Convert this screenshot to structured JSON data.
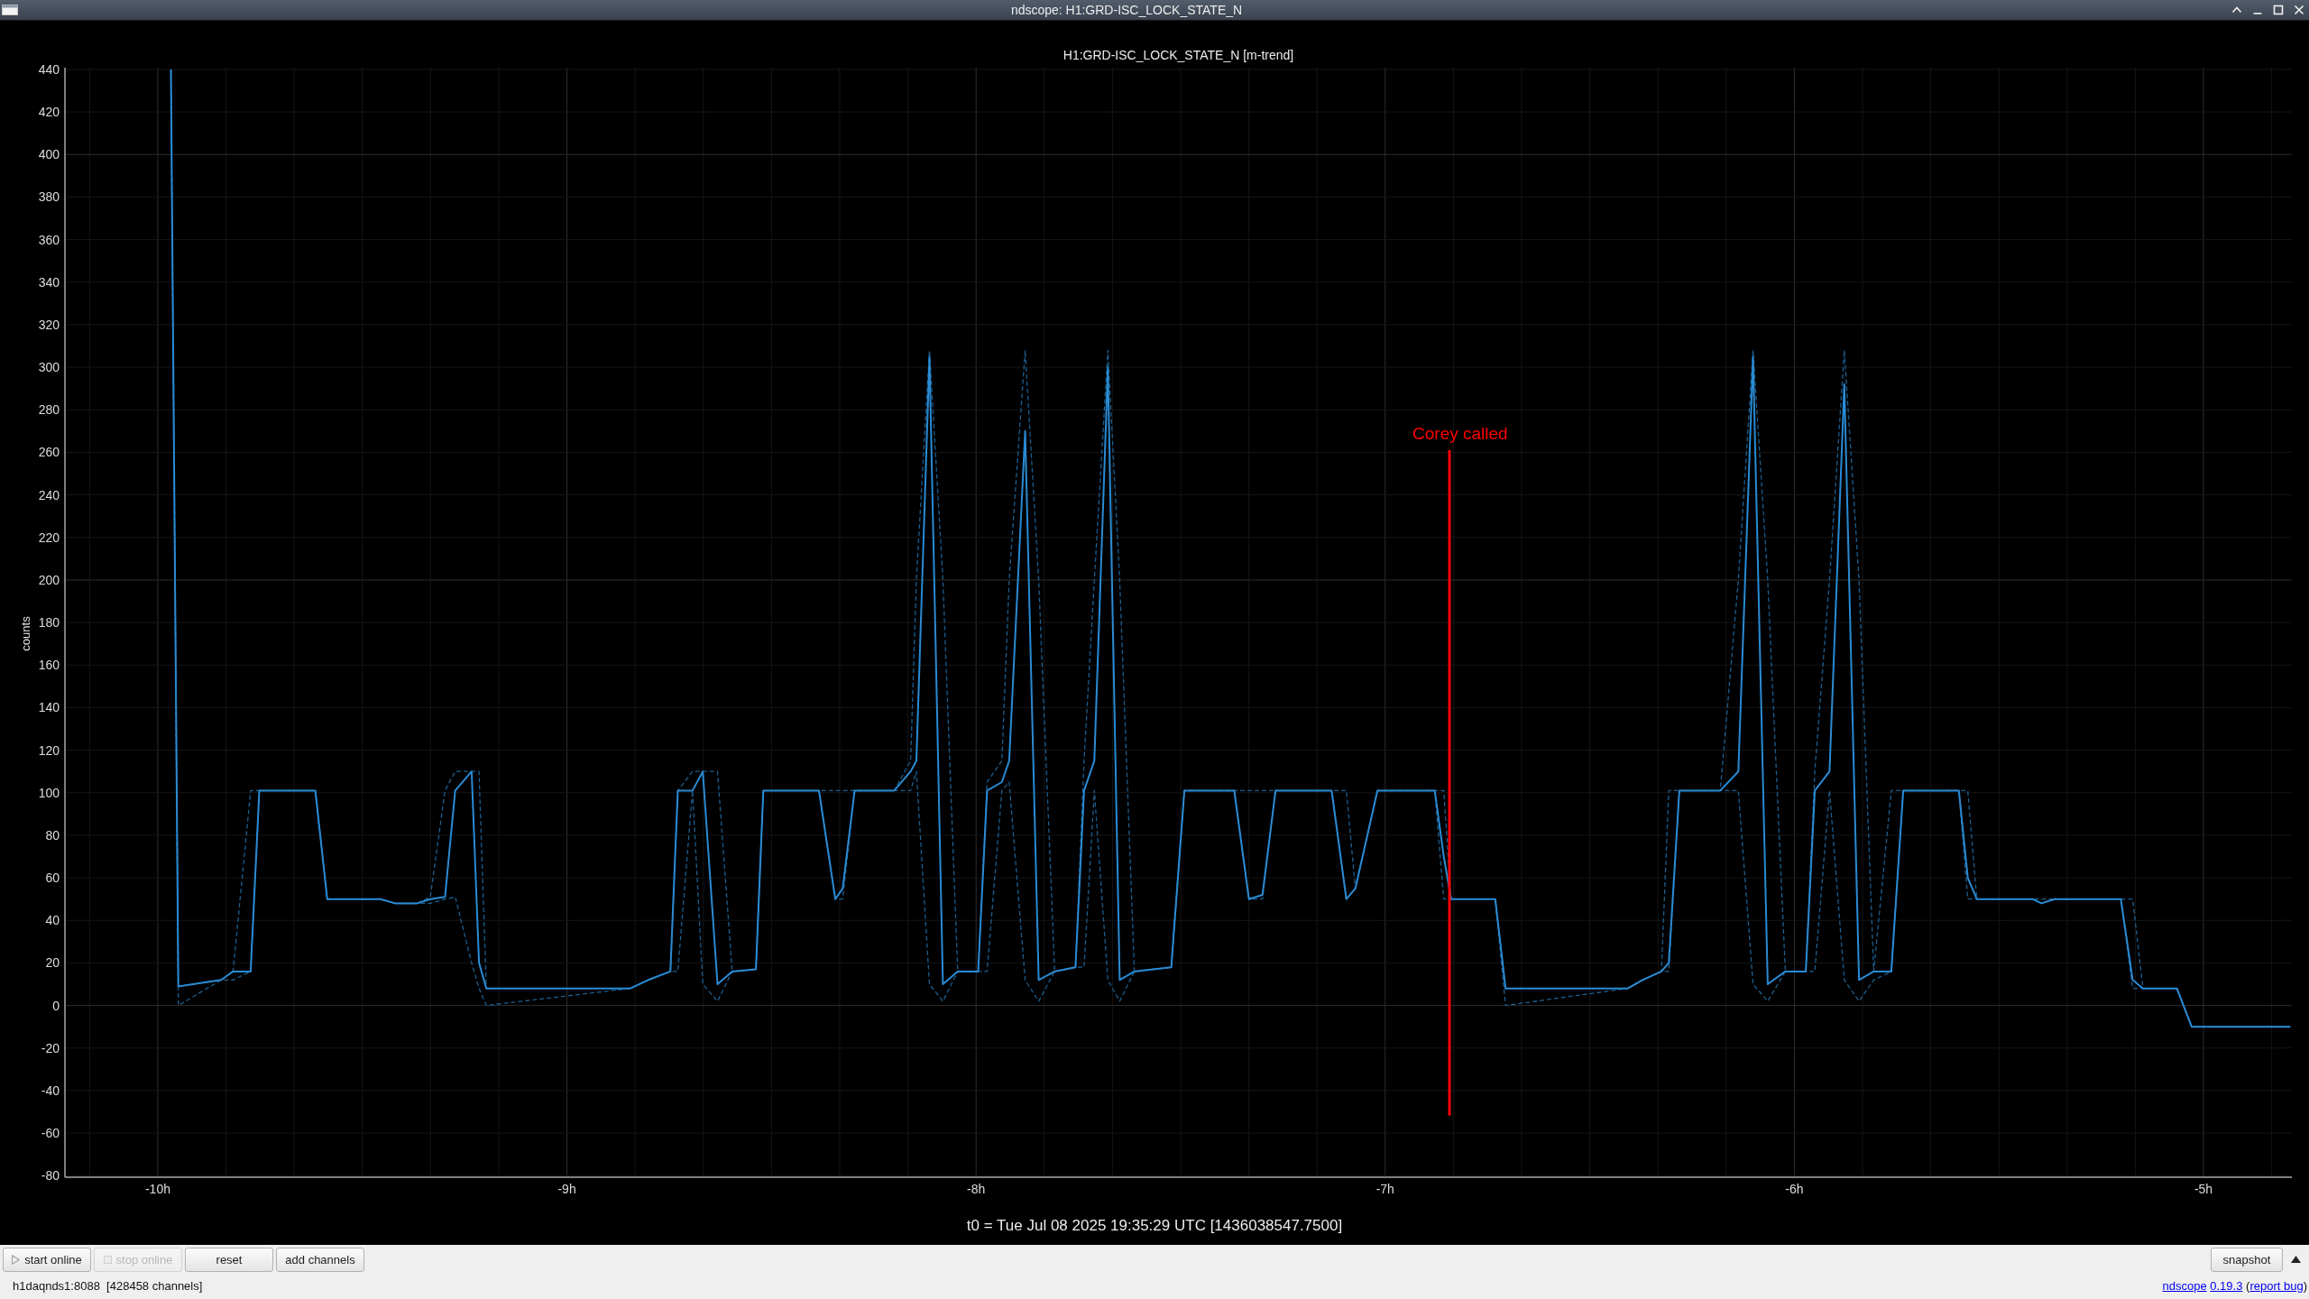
{
  "window": {
    "title": "ndscope: H1:GRD-ISC_LOCK_STATE_N"
  },
  "plot": {
    "chart_data": {
      "type": "line",
      "title": "H1:GRD-ISC_LOCK_STATE_N [m-trend]",
      "xlabel": "t0 = Tue Jul 08 2025 19:35:29 UTC [1436038547.7500]",
      "ylabel": "counts",
      "grid": true,
      "x": [
        -9.968,
        -9.95,
        -9.845,
        -9.816,
        -9.773,
        -9.752,
        -9.615,
        -9.586,
        -9.456,
        -9.42,
        -9.366,
        -9.334,
        -9.298,
        -9.273,
        -9.233,
        -9.215,
        -9.197,
        -8.845,
        -8.801,
        -8.747,
        -8.729,
        -8.693,
        -8.668,
        -8.632,
        -8.596,
        -8.538,
        -8.52,
        -8.384,
        -8.344,
        -8.326,
        -8.297,
        -8.2,
        -8.16,
        -8.146,
        -8.114,
        -8.081,
        -8.045,
        -7.995,
        -7.973,
        -7.937,
        -7.919,
        -7.88,
        -7.847,
        -7.808,
        -7.757,
        -7.736,
        -7.711,
        -7.678,
        -7.649,
        -7.613,
        -7.523,
        -7.491,
        -7.369,
        -7.333,
        -7.3,
        -7.268,
        -7.131,
        -7.095,
        -7.073,
        -7.019,
        -6.879,
        -6.857,
        -6.839,
        -6.731,
        -6.706,
        -6.407,
        -6.371,
        -6.325,
        -6.307,
        -6.281,
        -6.181,
        -6.137,
        -6.101,
        -6.065,
        -6.022,
        -5.972,
        -5.95,
        -5.914,
        -5.878,
        -5.842,
        -5.806,
        -5.763,
        -5.734,
        -5.598,
        -5.576,
        -5.554,
        -5.418,
        -5.396,
        -5.364,
        -5.202,
        -5.173,
        -5.148,
        -5.065,
        -5.029,
        -4.788
      ],
      "series": [
        {
          "line_style": "dashed",
          "color": "#1d5e8e",
          "values": [
            440,
            9,
            12,
            16,
            101,
            101,
            101,
            50,
            50,
            48,
            48,
            51,
            101,
            110,
            110,
            110,
            8,
            8,
            12,
            16,
            101,
            110,
            110,
            110,
            16,
            17,
            101,
            101,
            101,
            101,
            101,
            101,
            115,
            200,
            308,
            200,
            16,
            16,
            105,
            115,
            200,
            308,
            200,
            16,
            18,
            115,
            200,
            308,
            200,
            16,
            18,
            101,
            101,
            101,
            101,
            101,
            101,
            101,
            55,
            101,
            101,
            101,
            50,
            50,
            8,
            8,
            12,
            16,
            101,
            101,
            101,
            200,
            308,
            200,
            16,
            16,
            110,
            200,
            308,
            200,
            16,
            101,
            101,
            101,
            101,
            50,
            50,
            50,
            50,
            50,
            50,
            8,
            8,
            -10,
            -10
          ]
        },
        {
          "line_style": "dashed",
          "color": "#1d5e8e",
          "values": [
            440,
            0,
            12,
            12,
            16,
            101,
            101,
            50,
            50,
            48,
            48,
            48,
            50,
            51,
            20,
            8,
            0,
            8,
            12,
            16,
            16,
            101,
            10,
            2,
            16,
            17,
            101,
            101,
            50,
            50,
            101,
            101,
            101,
            110,
            10,
            2,
            16,
            16,
            16,
            101,
            105,
            12,
            2,
            16,
            18,
            18,
            101,
            12,
            2,
            16,
            18,
            101,
            101,
            50,
            50,
            101,
            101,
            50,
            55,
            101,
            101,
            50,
            50,
            50,
            0,
            8,
            12,
            16,
            16,
            101,
            101,
            101,
            10,
            2,
            16,
            16,
            16,
            101,
            12,
            2,
            12,
            16,
            101,
            101,
            50,
            50,
            50,
            48,
            50,
            50,
            8,
            8,
            8,
            -10,
            -10
          ]
        },
        {
          "line_style": "solid",
          "color": "#2a8bd4",
          "values": [
            440,
            9,
            12,
            16,
            16,
            101,
            101,
            50,
            50,
            48,
            48,
            50,
            51,
            101,
            110,
            20,
            8,
            8,
            12,
            16,
            101,
            101,
            110,
            10,
            16,
            17,
            101,
            101,
            50,
            55,
            101,
            101,
            110,
            115,
            305,
            10,
            16,
            16,
            101,
            105,
            115,
            270,
            12,
            16,
            18,
            101,
            115,
            300,
            12,
            16,
            18,
            101,
            101,
            50,
            52,
            101,
            101,
            50,
            55,
            101,
            101,
            70,
            50,
            50,
            8,
            8,
            12,
            16,
            20,
            101,
            101,
            110,
            305,
            10,
            16,
            16,
            101,
            110,
            292,
            12,
            16,
            16,
            101,
            101,
            60,
            50,
            50,
            48,
            50,
            50,
            12,
            8,
            8,
            -10,
            -10
          ]
        }
      ],
      "xlim": [
        -10.227,
        -4.784
      ],
      "ylim": [
        -80.3,
        440.8
      ],
      "xticks": [
        {
          "value": -10,
          "label": "-10h"
        },
        {
          "value": -9,
          "label": "-9h"
        },
        {
          "value": -8,
          "label": "-8h"
        },
        {
          "value": -7,
          "label": "-7h"
        },
        {
          "value": -6,
          "label": "-6h"
        },
        {
          "value": -5,
          "label": "-5h"
        }
      ],
      "yticks": [
        -80,
        -60,
        -40,
        -20,
        0,
        20,
        40,
        60,
        80,
        100,
        120,
        140,
        160,
        180,
        200,
        220,
        240,
        260,
        280,
        300,
        320,
        340,
        360,
        380,
        400,
        420,
        440
      ],
      "ref_lines": [
        {
          "axis": "x",
          "value": -6.843,
          "label": "Corey called",
          "color": "#ff0000"
        }
      ]
    }
  },
  "toolbar": {
    "buttons": [
      {
        "label": "start online",
        "kind": "play",
        "disabled": false
      },
      {
        "label": "stop online",
        "kind": "stop",
        "disabled": true
      },
      {
        "label": "reset",
        "kind": "text",
        "disabled": false
      },
      {
        "label": "add channels",
        "kind": "text",
        "disabled": false
      }
    ],
    "snapshot": {
      "label": "snapshot"
    }
  },
  "status_bar": {
    "connection": "h1daqnds1:8088  [428458 channels]",
    "about": [
      {
        "kind": "link",
        "text": "ndscope"
      },
      {
        "kind": "link",
        "text": "0.19.3"
      },
      {
        "kind": "text",
        "text": " ("
      },
      {
        "kind": "link",
        "text": "report bug"
      },
      {
        "kind": "text",
        "text": ")"
      }
    ]
  }
}
